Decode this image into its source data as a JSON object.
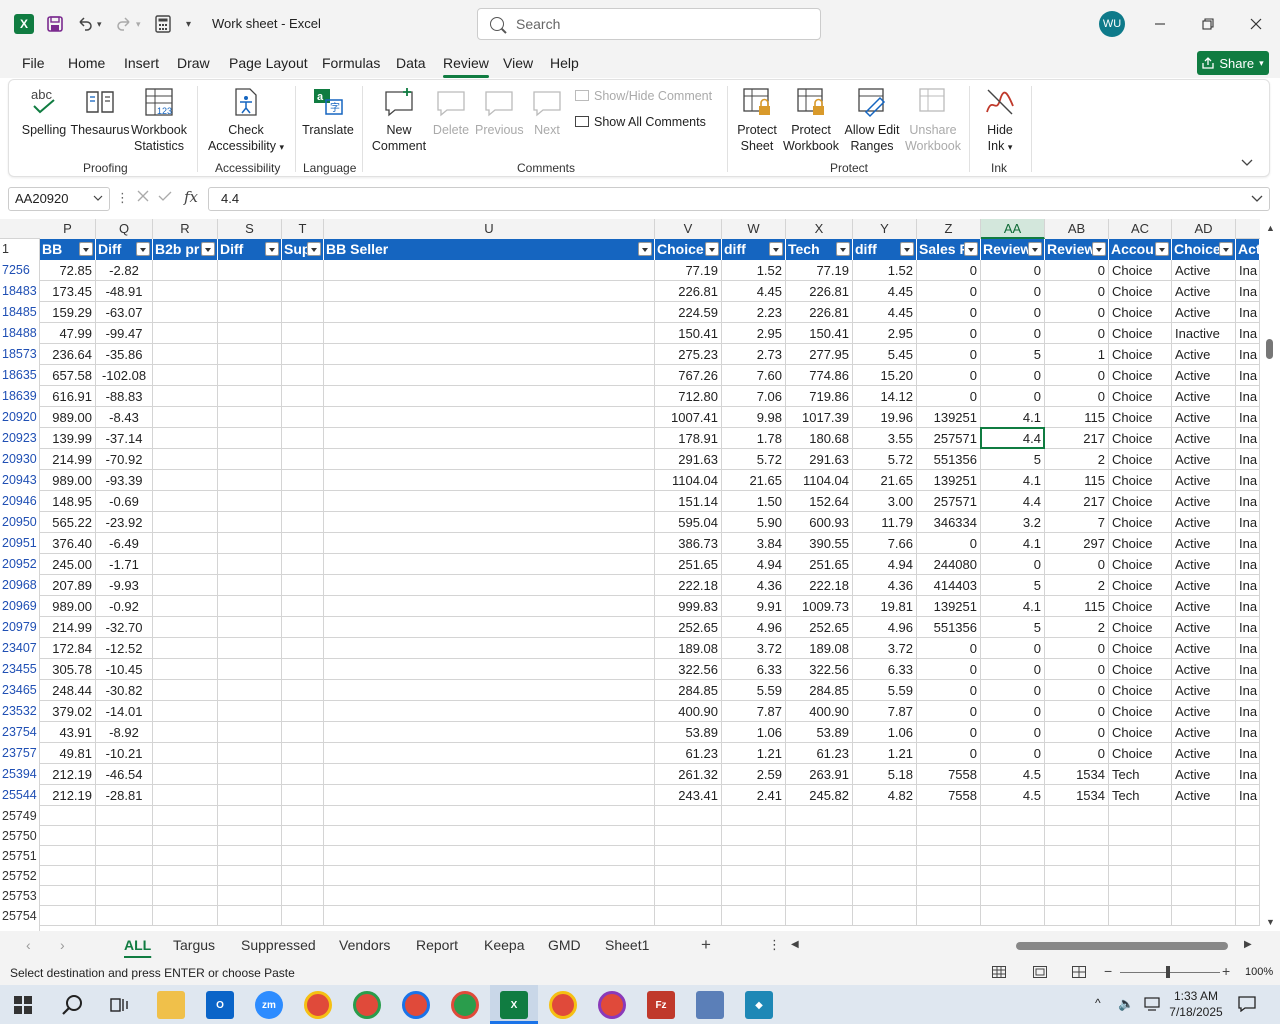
{
  "app": {
    "window_title": "Work sheet  -  Excel",
    "search_placeholder": "Search",
    "user_initials": "WU",
    "share_label": "Share"
  },
  "menu": [
    "File",
    "Home",
    "Insert",
    "Draw",
    "Page Layout",
    "Formulas",
    "Data",
    "Review",
    "View",
    "Help"
  ],
  "active_menu": "Review",
  "ribbon": {
    "proofing": {
      "spelling": "Spelling",
      "thesaurus": "Thesaurus",
      "workbook_stats_1": "Workbook",
      "workbook_stats_2": "Statistics",
      "label": "Proofing"
    },
    "accessibility": {
      "check_1": "Check",
      "check_2": "Accessibility",
      "label": "Accessibility"
    },
    "language": {
      "translate": "Translate",
      "label": "Language"
    },
    "comments": {
      "new_1": "New",
      "new_2": "Comment",
      "delete": "Delete",
      "previous": "Previous",
      "next": "Next",
      "show_hide": "Show/Hide Comment",
      "show_all": "Show All Comments",
      "label": "Comments"
    },
    "protect": {
      "sheet_1": "Protect",
      "sheet_2": "Sheet",
      "workbook_1": "Protect",
      "workbook_2": "Workbook",
      "allow_1": "Allow Edit",
      "allow_2": "Ranges",
      "unshare_1": "Unshare",
      "unshare_2": "Workbook",
      "label": "Protect"
    },
    "ink": {
      "hide_1": "Hide",
      "hide_2": "Ink",
      "label": "Ink"
    }
  },
  "formula_bar": {
    "name_box": "AA20920",
    "formula": "4.4"
  },
  "columns": [
    "P",
    "Q",
    "R",
    "S",
    "T",
    "U",
    "V",
    "W",
    "X",
    "Y",
    "Z",
    "AA",
    "AB",
    "AC",
    "AD"
  ],
  "selected_column": "AA",
  "header_row_number": "1",
  "table_headers": [
    "BB",
    "Diff",
    "B2b pr",
    "Diff",
    "Sup",
    "BB Seller",
    "Choice",
    "diff",
    "Tech",
    "diff",
    "Sales F",
    "Review",
    "Review",
    "Accou",
    "Choice",
    "Act"
  ],
  "rows": [
    {
      "r": "7256",
      "c": [
        "72.85",
        "-2.82",
        "",
        "",
        "",
        "",
        "77.19",
        "1.52",
        "77.19",
        "1.52",
        "0",
        "0",
        "0",
        "Choice",
        "Active",
        "Ina"
      ]
    },
    {
      "r": "18483",
      "c": [
        "173.45",
        "-48.91",
        "",
        "",
        "",
        "",
        "226.81",
        "4.45",
        "226.81",
        "4.45",
        "0",
        "0",
        "0",
        "Choice",
        "Active",
        "Ina"
      ]
    },
    {
      "r": "18485",
      "c": [
        "159.29",
        "-63.07",
        "",
        "",
        "",
        "",
        "224.59",
        "2.23",
        "226.81",
        "4.45",
        "0",
        "0",
        "0",
        "Choice",
        "Active",
        "Ina"
      ]
    },
    {
      "r": "18488",
      "c": [
        "47.99",
        "-99.47",
        "",
        "",
        "",
        "",
        "150.41",
        "2.95",
        "150.41",
        "2.95",
        "0",
        "0",
        "0",
        "Choice",
        "Inactive",
        "Ina"
      ]
    },
    {
      "r": "18573",
      "c": [
        "236.64",
        "-35.86",
        "",
        "",
        "",
        "",
        "275.23",
        "2.73",
        "277.95",
        "5.45",
        "0",
        "5",
        "1",
        "Choice",
        "Active",
        "Ina"
      ]
    },
    {
      "r": "18635",
      "c": [
        "657.58",
        "-102.08",
        "",
        "",
        "",
        "",
        "767.26",
        "7.60",
        "774.86",
        "15.20",
        "0",
        "0",
        "0",
        "Choice",
        "Active",
        "Ina"
      ]
    },
    {
      "r": "18639",
      "c": [
        "616.91",
        "-88.83",
        "",
        "",
        "",
        "",
        "712.80",
        "7.06",
        "719.86",
        "14.12",
        "0",
        "0",
        "0",
        "Choice",
        "Active",
        "Ina"
      ]
    },
    {
      "r": "20920",
      "c": [
        "989.00",
        "-8.43",
        "",
        "",
        "",
        "",
        "1007.41",
        "9.98",
        "1017.39",
        "19.96",
        "139251",
        "4.1",
        "115",
        "Choice",
        "Active",
        "Ina"
      ]
    },
    {
      "r": "20923",
      "c": [
        "139.99",
        "-37.14",
        "",
        "",
        "",
        "",
        "178.91",
        "1.78",
        "180.68",
        "3.55",
        "257571",
        "4.4",
        "217",
        "Choice",
        "Active",
        "Ina"
      ]
    },
    {
      "r": "20930",
      "c": [
        "214.99",
        "-70.92",
        "",
        "",
        "",
        "",
        "291.63",
        "5.72",
        "291.63",
        "5.72",
        "551356",
        "5",
        "2",
        "Choice",
        "Active",
        "Ina"
      ]
    },
    {
      "r": "20943",
      "c": [
        "989.00",
        "-93.39",
        "",
        "",
        "",
        "",
        "1104.04",
        "21.65",
        "1104.04",
        "21.65",
        "139251",
        "4.1",
        "115",
        "Choice",
        "Active",
        "Ina"
      ]
    },
    {
      "r": "20946",
      "c": [
        "148.95",
        "-0.69",
        "",
        "",
        "",
        "",
        "151.14",
        "1.50",
        "152.64",
        "3.00",
        "257571",
        "4.4",
        "217",
        "Choice",
        "Active",
        "Ina"
      ]
    },
    {
      "r": "20950",
      "c": [
        "565.22",
        "-23.92",
        "",
        "",
        "",
        "",
        "595.04",
        "5.90",
        "600.93",
        "11.79",
        "346334",
        "3.2",
        "7",
        "Choice",
        "Active",
        "Ina"
      ]
    },
    {
      "r": "20951",
      "c": [
        "376.40",
        "-6.49",
        "",
        "",
        "",
        "",
        "386.73",
        "3.84",
        "390.55",
        "7.66",
        "0",
        "4.1",
        "297",
        "Choice",
        "Active",
        "Ina"
      ]
    },
    {
      "r": "20952",
      "c": [
        "245.00",
        "-1.71",
        "",
        "",
        "",
        "",
        "251.65",
        "4.94",
        "251.65",
        "4.94",
        "244080",
        "0",
        "0",
        "Choice",
        "Active",
        "Ina"
      ]
    },
    {
      "r": "20968",
      "c": [
        "207.89",
        "-9.93",
        "",
        "",
        "",
        "",
        "222.18",
        "4.36",
        "222.18",
        "4.36",
        "414403",
        "5",
        "2",
        "Choice",
        "Active",
        "Ina"
      ]
    },
    {
      "r": "20969",
      "c": [
        "989.00",
        "-0.92",
        "",
        "",
        "",
        "",
        "999.83",
        "9.91",
        "1009.73",
        "19.81",
        "139251",
        "4.1",
        "115",
        "Choice",
        "Active",
        "Ina"
      ]
    },
    {
      "r": "20979",
      "c": [
        "214.99",
        "-32.70",
        "",
        "",
        "",
        "",
        "252.65",
        "4.96",
        "252.65",
        "4.96",
        "551356",
        "5",
        "2",
        "Choice",
        "Active",
        "Ina"
      ]
    },
    {
      "r": "23407",
      "c": [
        "172.84",
        "-12.52",
        "",
        "",
        "",
        "",
        "189.08",
        "3.72",
        "189.08",
        "3.72",
        "0",
        "0",
        "0",
        "Choice",
        "Active",
        "Ina"
      ]
    },
    {
      "r": "23455",
      "c": [
        "305.78",
        "-10.45",
        "",
        "",
        "",
        "",
        "322.56",
        "6.33",
        "322.56",
        "6.33",
        "0",
        "0",
        "0",
        "Choice",
        "Active",
        "Ina"
      ]
    },
    {
      "r": "23465",
      "c": [
        "248.44",
        "-30.82",
        "",
        "",
        "",
        "",
        "284.85",
        "5.59",
        "284.85",
        "5.59",
        "0",
        "0",
        "0",
        "Choice",
        "Active",
        "Ina"
      ]
    },
    {
      "r": "23532",
      "c": [
        "379.02",
        "-14.01",
        "",
        "",
        "",
        "",
        "400.90",
        "7.87",
        "400.90",
        "7.87",
        "0",
        "0",
        "0",
        "Choice",
        "Active",
        "Ina"
      ]
    },
    {
      "r": "23754",
      "c": [
        "43.91",
        "-8.92",
        "",
        "",
        "",
        "",
        "53.89",
        "1.06",
        "53.89",
        "1.06",
        "0",
        "0",
        "0",
        "Choice",
        "Active",
        "Ina"
      ]
    },
    {
      "r": "23757",
      "c": [
        "49.81",
        "-10.21",
        "",
        "",
        "",
        "",
        "61.23",
        "1.21",
        "61.23",
        "1.21",
        "0",
        "0",
        "0",
        "Choice",
        "Active",
        "Ina"
      ]
    },
    {
      "r": "25394",
      "c": [
        "212.19",
        "-46.54",
        "",
        "",
        "",
        "",
        "261.32",
        "2.59",
        "263.91",
        "5.18",
        "7558",
        "4.5",
        "1534",
        "Tech",
        "Active",
        "Ina"
      ]
    },
    {
      "r": "25544",
      "c": [
        "212.19",
        "-28.81",
        "",
        "",
        "",
        "",
        "243.41",
        "2.41",
        "245.82",
        "4.82",
        "7558",
        "4.5",
        "1534",
        "Tech",
        "Active",
        "Ina"
      ]
    }
  ],
  "empty_rows": [
    "25749",
    "25750",
    "25751",
    "25752",
    "25753",
    "25754"
  ],
  "sheets": [
    "ALL",
    "Targus",
    "Suppressed",
    "Vendors",
    "Report",
    "Keepa",
    "GMD",
    "Sheet1"
  ],
  "active_sheet": "ALL",
  "status": {
    "message": "Select destination and press ENTER or choose Paste",
    "zoom": "100%"
  },
  "taskbar": {
    "time": "1:33 AM",
    "date": "7/18/2025"
  },
  "colors": {
    "excel_green": "#107c41",
    "table_header": "#1565c0",
    "row_number": "#1f4fb4"
  }
}
